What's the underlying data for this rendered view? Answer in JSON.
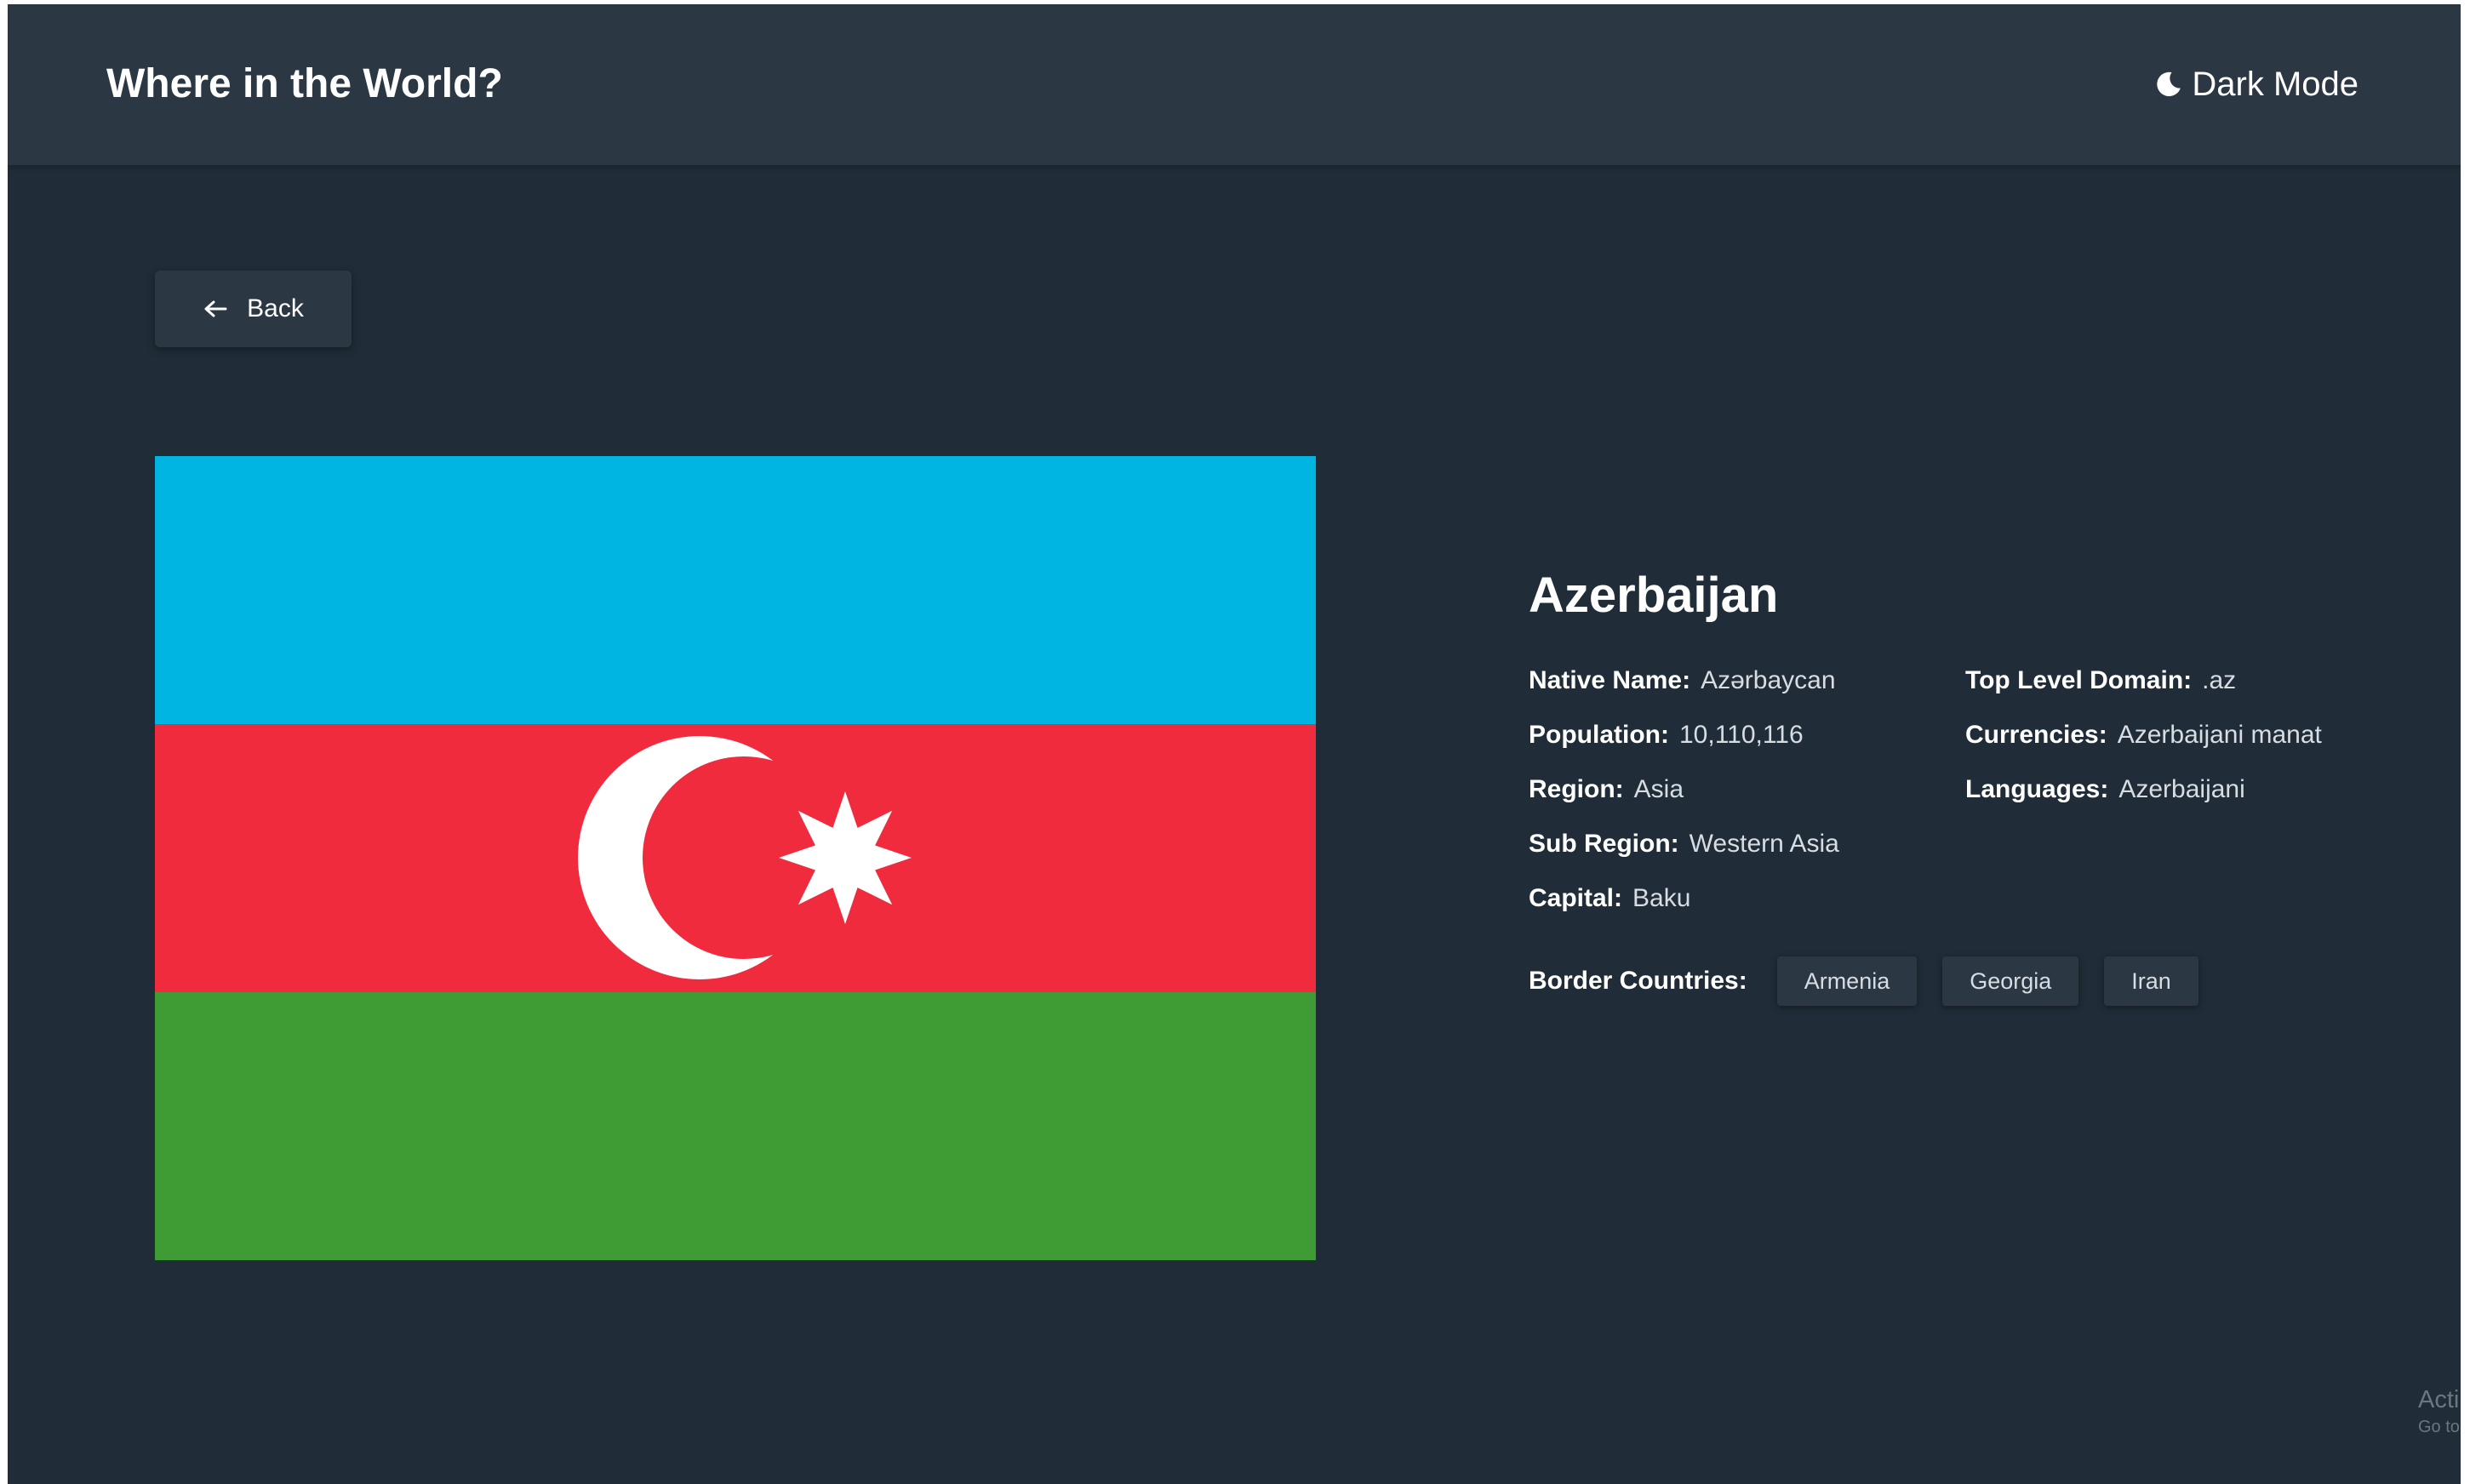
{
  "header": {
    "title": "Where in the World?",
    "mode_label": "Dark Mode"
  },
  "back_button": {
    "label": "Back"
  },
  "country": {
    "name": "Azerbaijan",
    "flag": {
      "stripes": [
        "#00b5e2",
        "#ef2b3d",
        "#3f9c35"
      ],
      "emblem_color": "#ffffff",
      "alt": "Flag of Azerbaijan"
    },
    "info_left": [
      {
        "label": "Native Name:",
        "value": "Azərbaycan"
      },
      {
        "label": "Population:",
        "value": "10,110,116"
      },
      {
        "label": "Region:",
        "value": "Asia"
      },
      {
        "label": "Sub Region:",
        "value": "Western Asia"
      },
      {
        "label": "Capital:",
        "value": "Baku"
      }
    ],
    "info_right": [
      {
        "label": "Top Level Domain:",
        "value": ".az"
      },
      {
        "label": "Currencies:",
        "value": "Azerbaijani manat"
      },
      {
        "label": "Languages:",
        "value": "Azerbaijani"
      }
    ],
    "border_label": "Border Countries:",
    "borders": [
      "Armenia",
      "Georgia",
      "Iran"
    ]
  },
  "watermark": {
    "line1": "Acti",
    "line2": "Go to"
  },
  "icons": {
    "mode": "moon-icon",
    "back": "arrow-left-icon"
  },
  "colors": {
    "background": "#202c37",
    "elements": "#2b3844",
    "text": "#ffffff"
  }
}
